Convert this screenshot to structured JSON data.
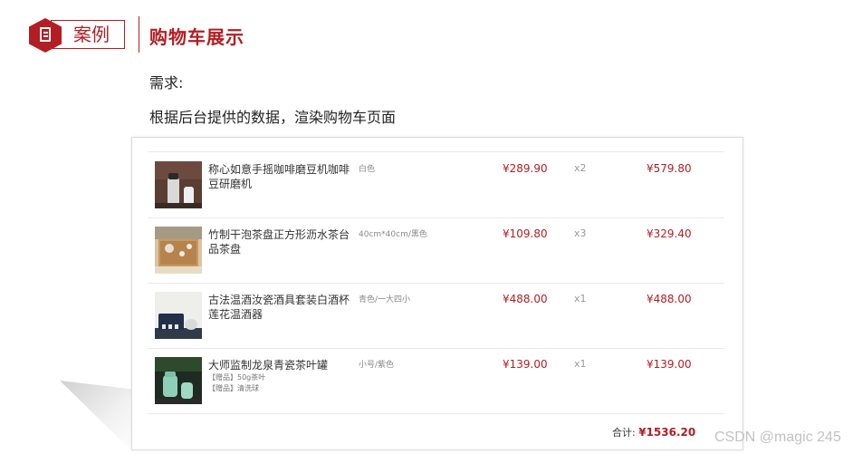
{
  "header": {
    "badge_label": "案例",
    "title": "购物车展示"
  },
  "requirement": {
    "label": "需求:",
    "text": "根据后台提供的数据，渲染购物车页面"
  },
  "cart": {
    "items": [
      {
        "name": "称心如意手摇咖啡磨豆机咖啡豆研磨机",
        "spec": "白色",
        "price": "¥289.90",
        "qty": "x2",
        "subtotal": "¥579.80",
        "gifts": []
      },
      {
        "name": "竹制干泡茶盘正方形沥水茶台品茶盘",
        "spec": "40cm*40cm/黑色",
        "price": "¥109.80",
        "qty": "x3",
        "subtotal": "¥329.40",
        "gifts": []
      },
      {
        "name": "古法温酒汝瓷酒具套装白酒杯莲花温酒器",
        "spec": "青色/一大四小",
        "price": "¥488.00",
        "qty": "x1",
        "subtotal": "¥488.00",
        "gifts": []
      },
      {
        "name": "大师监制龙泉青瓷茶叶罐",
        "spec": "小号/紫色",
        "price": "¥139.00",
        "qty": "x1",
        "subtotal": "¥139.00",
        "gifts": [
          "【赠品】50g茶叶",
          "【赠品】清洗球"
        ]
      }
    ],
    "total_label": "合计:",
    "total_value": "¥1536.20"
  },
  "watermark": "CSDN @magic 245",
  "colors": {
    "accent": "#b21e23",
    "muted": "#888888",
    "border": "#e8e8e8"
  }
}
